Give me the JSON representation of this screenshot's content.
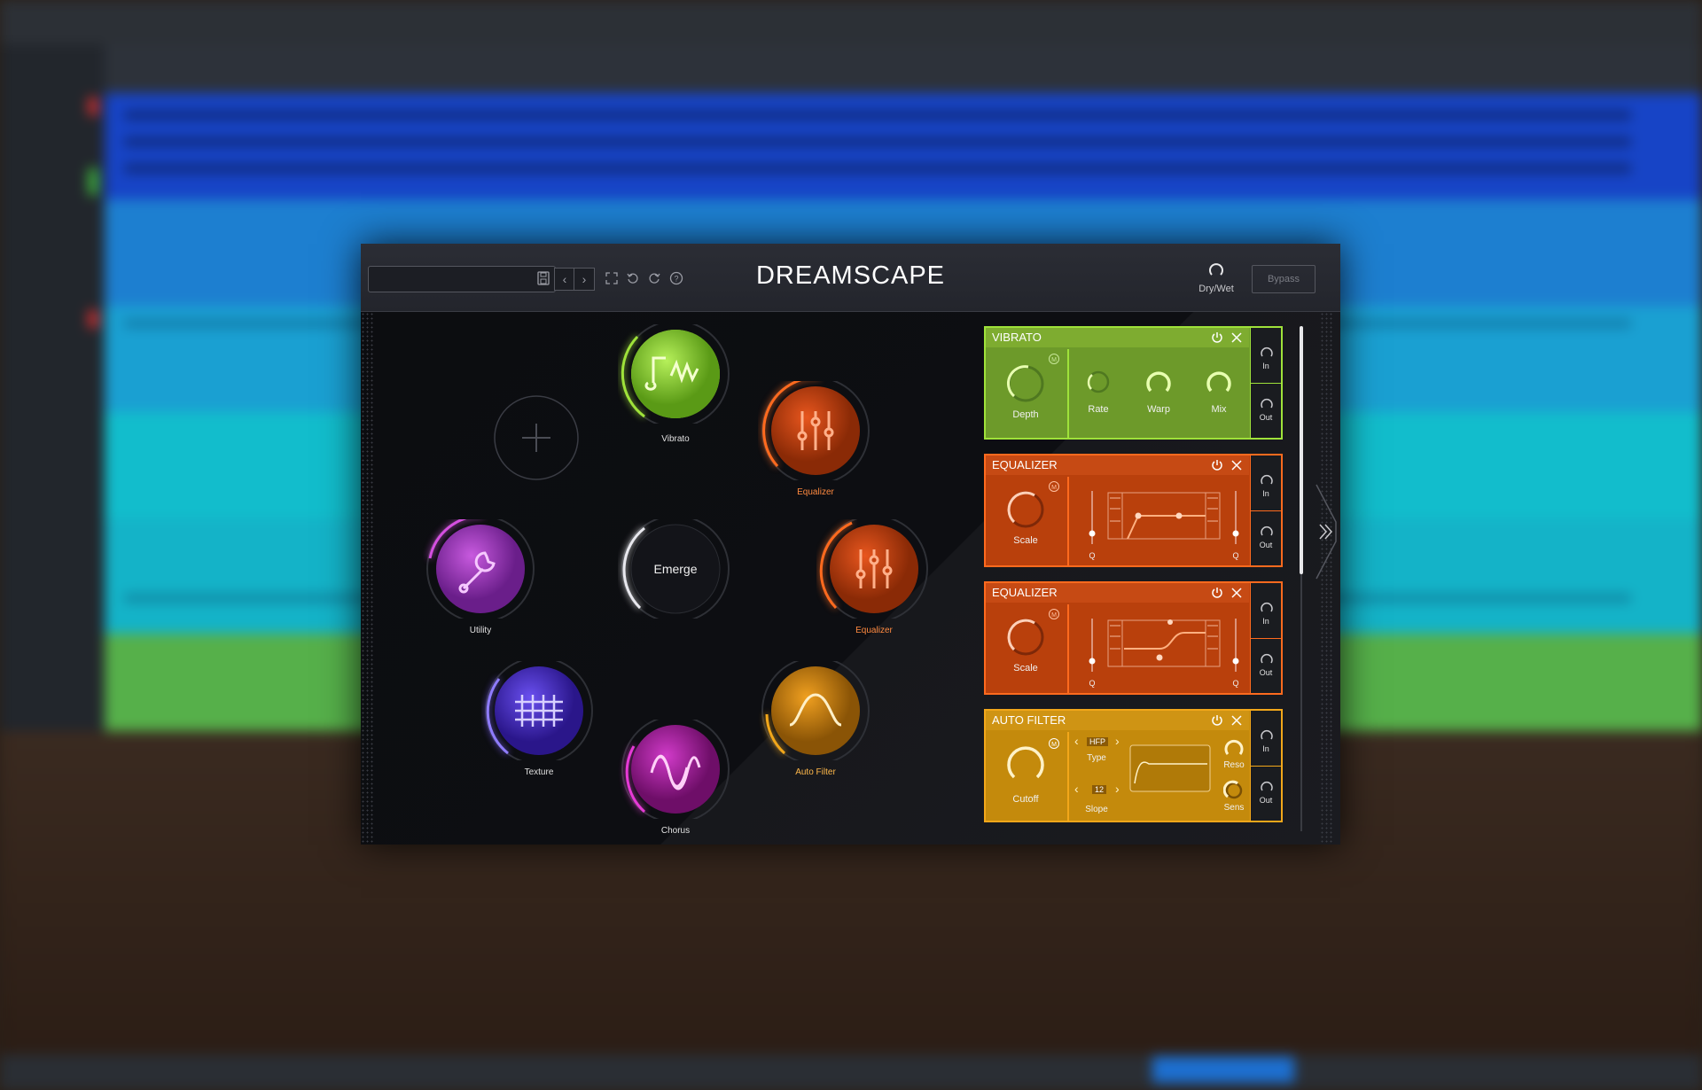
{
  "plugin": {
    "title": "DREAMSCAPE",
    "preset_name": "",
    "dry_wet_label": "Dry/Wet",
    "bypass_label": "Bypass"
  },
  "modules": {
    "vibrato": "Vibrato",
    "equalizer_1": "Equalizer",
    "utility": "Utility",
    "emerge": "Emerge",
    "equalizer_2": "Equalizer",
    "texture": "Texture",
    "chorus": "Chorus",
    "auto_filter": "Auto Filter"
  },
  "panels": {
    "vibrato": {
      "title": "VIBRATO",
      "knobs": [
        "Depth",
        "Rate",
        "Warp",
        "Mix"
      ],
      "in": "In",
      "out": "Out",
      "color": "#6d9a2a"
    },
    "equalizer_1": {
      "title": "EQUALIZER",
      "knob": "Scale",
      "q_left": "Q",
      "q_right": "Q",
      "in": "In",
      "out": "Out",
      "color": "#b9400c"
    },
    "equalizer_2": {
      "title": "EQUALIZER",
      "knob": "Scale",
      "q_left": "Q",
      "q_right": "Q",
      "in": "In",
      "out": "Out",
      "color": "#b9400c"
    },
    "auto_filter": {
      "title": "AUTO FILTER",
      "knob": "Cutoff",
      "type_label": "Type",
      "type_value": "HFP",
      "slope_label": "Slope",
      "slope_value": "12",
      "reso": "Reso",
      "sens": "Sens",
      "in": "In",
      "out": "Out",
      "color": "#c48a0c"
    }
  },
  "colors": {
    "vibrato": "#9fe23a",
    "equalizer": "#ff6a1e",
    "utility": "#d54fe0",
    "texture": "#6a3df0",
    "chorus": "#e63ad6",
    "auto_filter": "#f2a71a",
    "emerge": "#e8e8ee"
  }
}
